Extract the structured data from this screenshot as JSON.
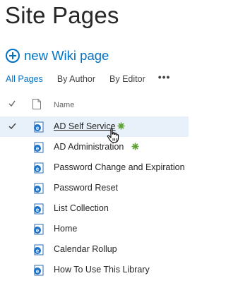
{
  "page": {
    "title": "Site Pages"
  },
  "toolbar": {
    "new_wiki_label": "new Wiki page"
  },
  "views": {
    "items": [
      {
        "label": "All Pages",
        "active": true
      },
      {
        "label": "By Author",
        "active": false
      },
      {
        "label": "By Editor",
        "active": false
      }
    ],
    "more_label": "•••"
  },
  "list": {
    "header_name": "Name",
    "rows": [
      {
        "name": "AD Self Service",
        "selected": true,
        "new": true
      },
      {
        "name": "AD Administration",
        "selected": false,
        "new": true
      },
      {
        "name": "Password Change and Expiration",
        "selected": false,
        "new": false
      },
      {
        "name": "Password Reset",
        "selected": false,
        "new": false
      },
      {
        "name": "List Collection",
        "selected": false,
        "new": false
      },
      {
        "name": "Home",
        "selected": false,
        "new": false
      },
      {
        "name": "Calendar Rollup",
        "selected": false,
        "new": false
      },
      {
        "name": "How To Use This Library",
        "selected": false,
        "new": false
      }
    ]
  },
  "colors": {
    "accent": "#0072c6",
    "selected_row": "#e8f1fa",
    "new_icon": "#5ca22f"
  }
}
